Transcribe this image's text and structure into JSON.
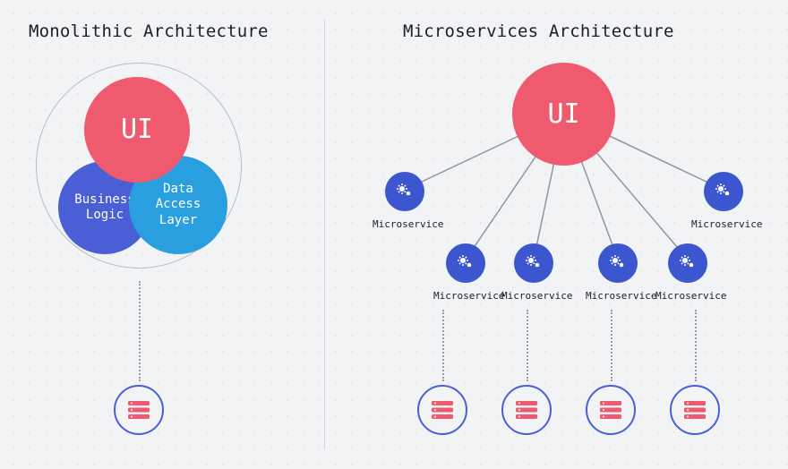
{
  "left": {
    "title": "Monolithic Architecture",
    "ui_label": "UI",
    "business_label": "Business\nLogic",
    "data_label": "Data\nAccess\nLayer"
  },
  "right": {
    "title": "Microservices Architecture",
    "ui_label": "UI",
    "service_label": "Microservice",
    "services_row1_count": 2,
    "services_row2_count": 4,
    "server_count": 4
  },
  "colors": {
    "ui": "#ef5a6f",
    "business": "#4a5fd6",
    "data": "#2a9fe0",
    "service": "#3c56cf",
    "ring": "#b8bcc5"
  }
}
